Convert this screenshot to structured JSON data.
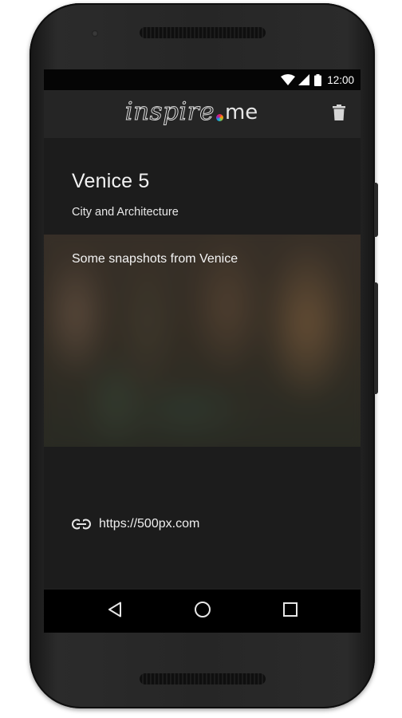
{
  "status_bar": {
    "time": "12:00",
    "icons": [
      "wifi-icon",
      "cellular-signal-icon",
      "battery-icon"
    ]
  },
  "app_bar": {
    "logo_text": "inspire",
    "logo_suffix": "me",
    "actions": [
      "delete-icon"
    ]
  },
  "card": {
    "title": "Venice 5",
    "subtitle": "City and Architecture",
    "image_caption": "Some snapshots from Venice",
    "link": {
      "icon": "link-icon",
      "text": "https://500px.com"
    }
  },
  "nav_bar": {
    "buttons": [
      "back-icon",
      "home-icon",
      "recents-icon"
    ]
  },
  "colors": {
    "status_bar": "#050505",
    "app_bar": "#252525",
    "card_background": "#1c1c1c",
    "nav_bar": "#000000",
    "text": "#f2f2f2"
  }
}
